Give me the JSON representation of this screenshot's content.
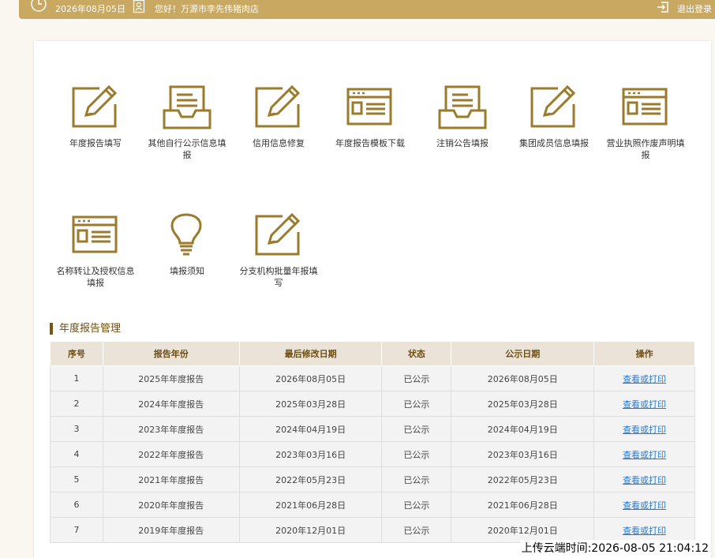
{
  "topbar": {
    "date": "2026年08月05日",
    "greeting": "您好！万源市李先伟猪肉店",
    "logout": "退出登录"
  },
  "tiles": [
    {
      "label": "年度报告填写",
      "icon": "edit-icon"
    },
    {
      "label": "其他自行公示信息填报",
      "icon": "inbox-icon"
    },
    {
      "label": "信用信息修复",
      "icon": "edit-icon"
    },
    {
      "label": "年度报告模板下载",
      "icon": "window-icon"
    },
    {
      "label": "注销公告填报",
      "icon": "inbox-icon"
    },
    {
      "label": "集团成员信息填报",
      "icon": "edit-icon"
    },
    {
      "label": "营业执照作废声明填报",
      "icon": "window-icon"
    },
    {
      "label": "名称转让及授权信息填报",
      "icon": "window-icon"
    },
    {
      "label": "填报须知",
      "icon": "lightbulb-icon"
    },
    {
      "label": "分支机构批量年报填写",
      "icon": "edit-icon"
    }
  ],
  "section": {
    "title": "年度报告管理"
  },
  "table": {
    "headers": [
      "序号",
      "报告年份",
      "最后修改日期",
      "状态",
      "公示日期",
      "操作"
    ],
    "rows": [
      [
        "1",
        "2025年年度报告",
        "2026年08月05日",
        "已公示",
        "2026年08月05日",
        "查看或打印"
      ],
      [
        "2",
        "2024年年度报告",
        "2025年03月28日",
        "已公示",
        "2025年03月28日",
        "查看或打印"
      ],
      [
        "3",
        "2023年年度报告",
        "2024年04月19日",
        "已公示",
        "2024年04月19日",
        "查看或打印"
      ],
      [
        "4",
        "2022年年度报告",
        "2023年03月16日",
        "已公示",
        "2023年03月16日",
        "查看或打印"
      ],
      [
        "5",
        "2021年年度报告",
        "2022年05月23日",
        "已公示",
        "2022年05月23日",
        "查看或打印"
      ],
      [
        "6",
        "2020年年度报告",
        "2021年06月28日",
        "已公示",
        "2021年06月28日",
        "查看或打印"
      ],
      [
        "7",
        "2019年年度报告",
        "2020年12月01日",
        "已公示",
        "2020年12月01日",
        "查看或打印"
      ]
    ]
  },
  "watermark": "上传云端时间:2026-08-05 21:04:12",
  "colors": {
    "accent": "#9b7a2c",
    "topbar": "#c9a862",
    "link": "#2a7ad0"
  }
}
